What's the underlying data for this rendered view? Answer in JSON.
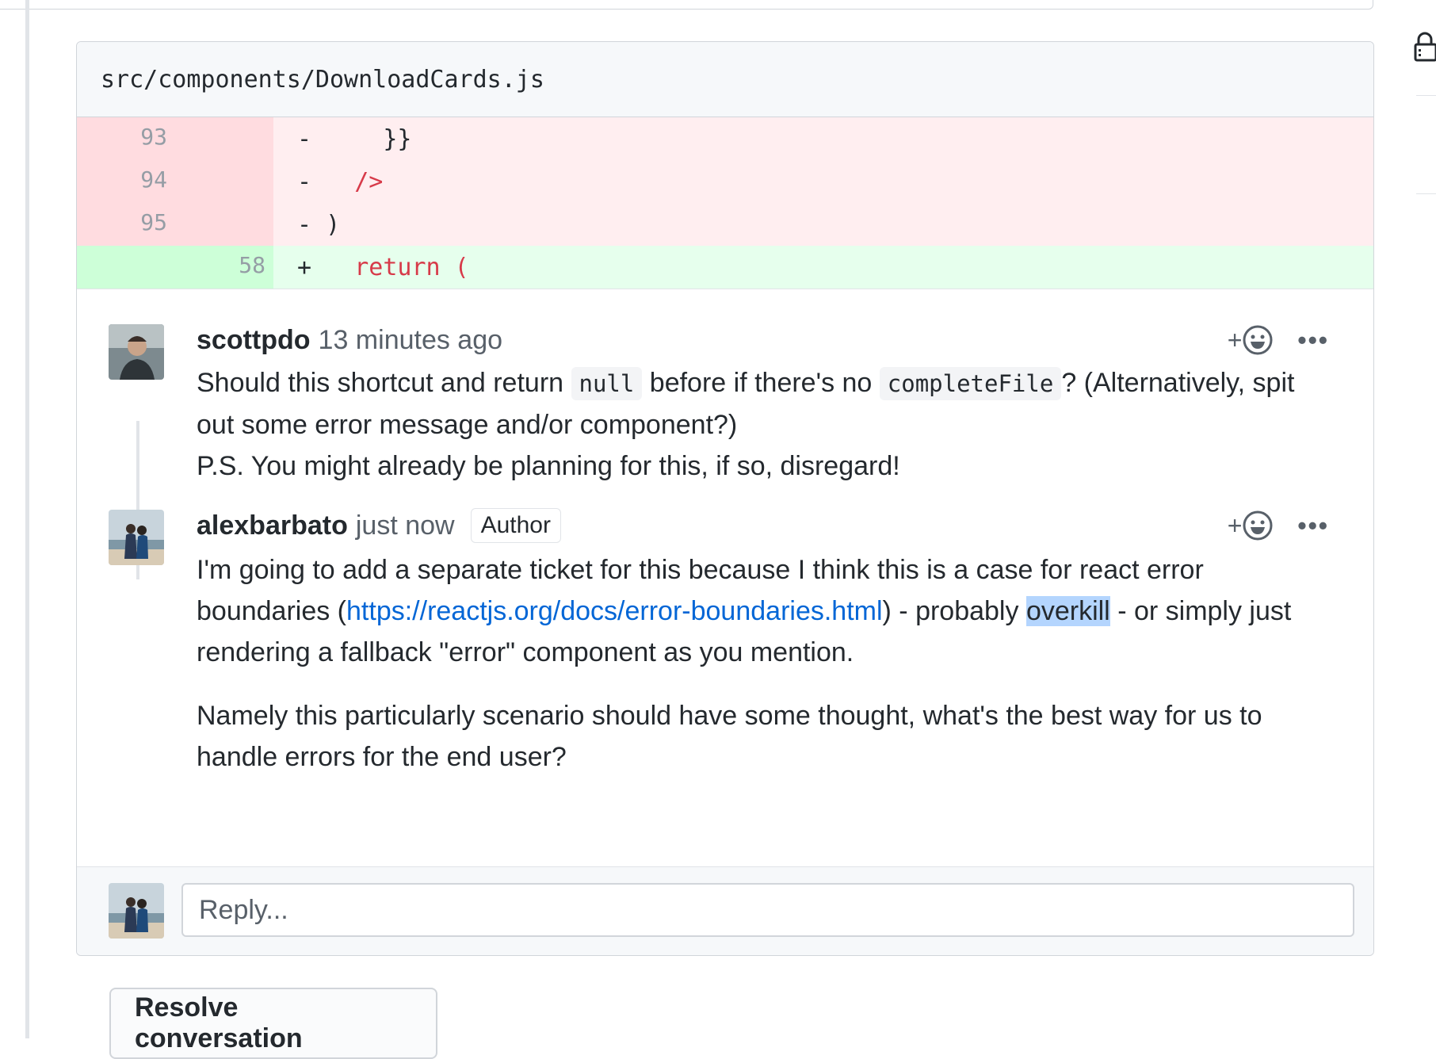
{
  "file": {
    "path": "src/components/DownloadCards.js"
  },
  "diff": {
    "rows": [
      {
        "type": "del",
        "old": "93",
        "new": "",
        "sign": "-",
        "code": "    }}"
      },
      {
        "type": "del",
        "old": "94",
        "new": "",
        "sign": "-",
        "code": "  />"
      },
      {
        "type": "del",
        "old": "95",
        "new": "",
        "sign": "-",
        "code": ")"
      },
      {
        "type": "add",
        "old": "",
        "new": "58",
        "sign": "+",
        "code": "  return ("
      }
    ]
  },
  "comments": [
    {
      "author": "scottpdo",
      "time": "13 minutes ago",
      "badge": "",
      "react_plus": "+",
      "more": "•••",
      "body": {
        "p1a": "Should this shortcut and return ",
        "code1": "null",
        "p1b": " before if there's no ",
        "code2": "completeFile",
        "p1c": "? (Alternatively, spit out some error message and/or component?)",
        "p2": "P.S. You might already be planning for this, if so, disregard!"
      }
    },
    {
      "author": "alexbarbato",
      "time": "just now",
      "badge": "Author",
      "react_plus": "+",
      "more": "•••",
      "body": {
        "p1a": "I'm going to add a separate ticket for this because I think this is a case for react error boundaries (",
        "link": "https://reactjs.org/docs/error-boundaries.html",
        "p1b": ") - probably ",
        "highlight": "overkill",
        "p1c": " - or simply just rendering a fallback \"error\" component as you mention.",
        "p2": "Namely this particularly scenario should have some thought, what's the best way for us to handle errors for the end user?"
      }
    }
  ],
  "reply": {
    "placeholder": "Reply..."
  },
  "resolve": {
    "label": "Resolve conversation"
  },
  "icons": {
    "lock": "lock-icon",
    "reaction": "smiley-icon",
    "more": "kebab-horizontal-icon"
  },
  "colors": {
    "deletion_bg": "#ffeef0",
    "deletion_gutter": "#ffdce0",
    "addition_bg": "#e6ffed",
    "addition_gutter": "#cdffd8",
    "link": "#0366d6",
    "keyword": "#d73a49",
    "selection": "#b4d5fe"
  }
}
